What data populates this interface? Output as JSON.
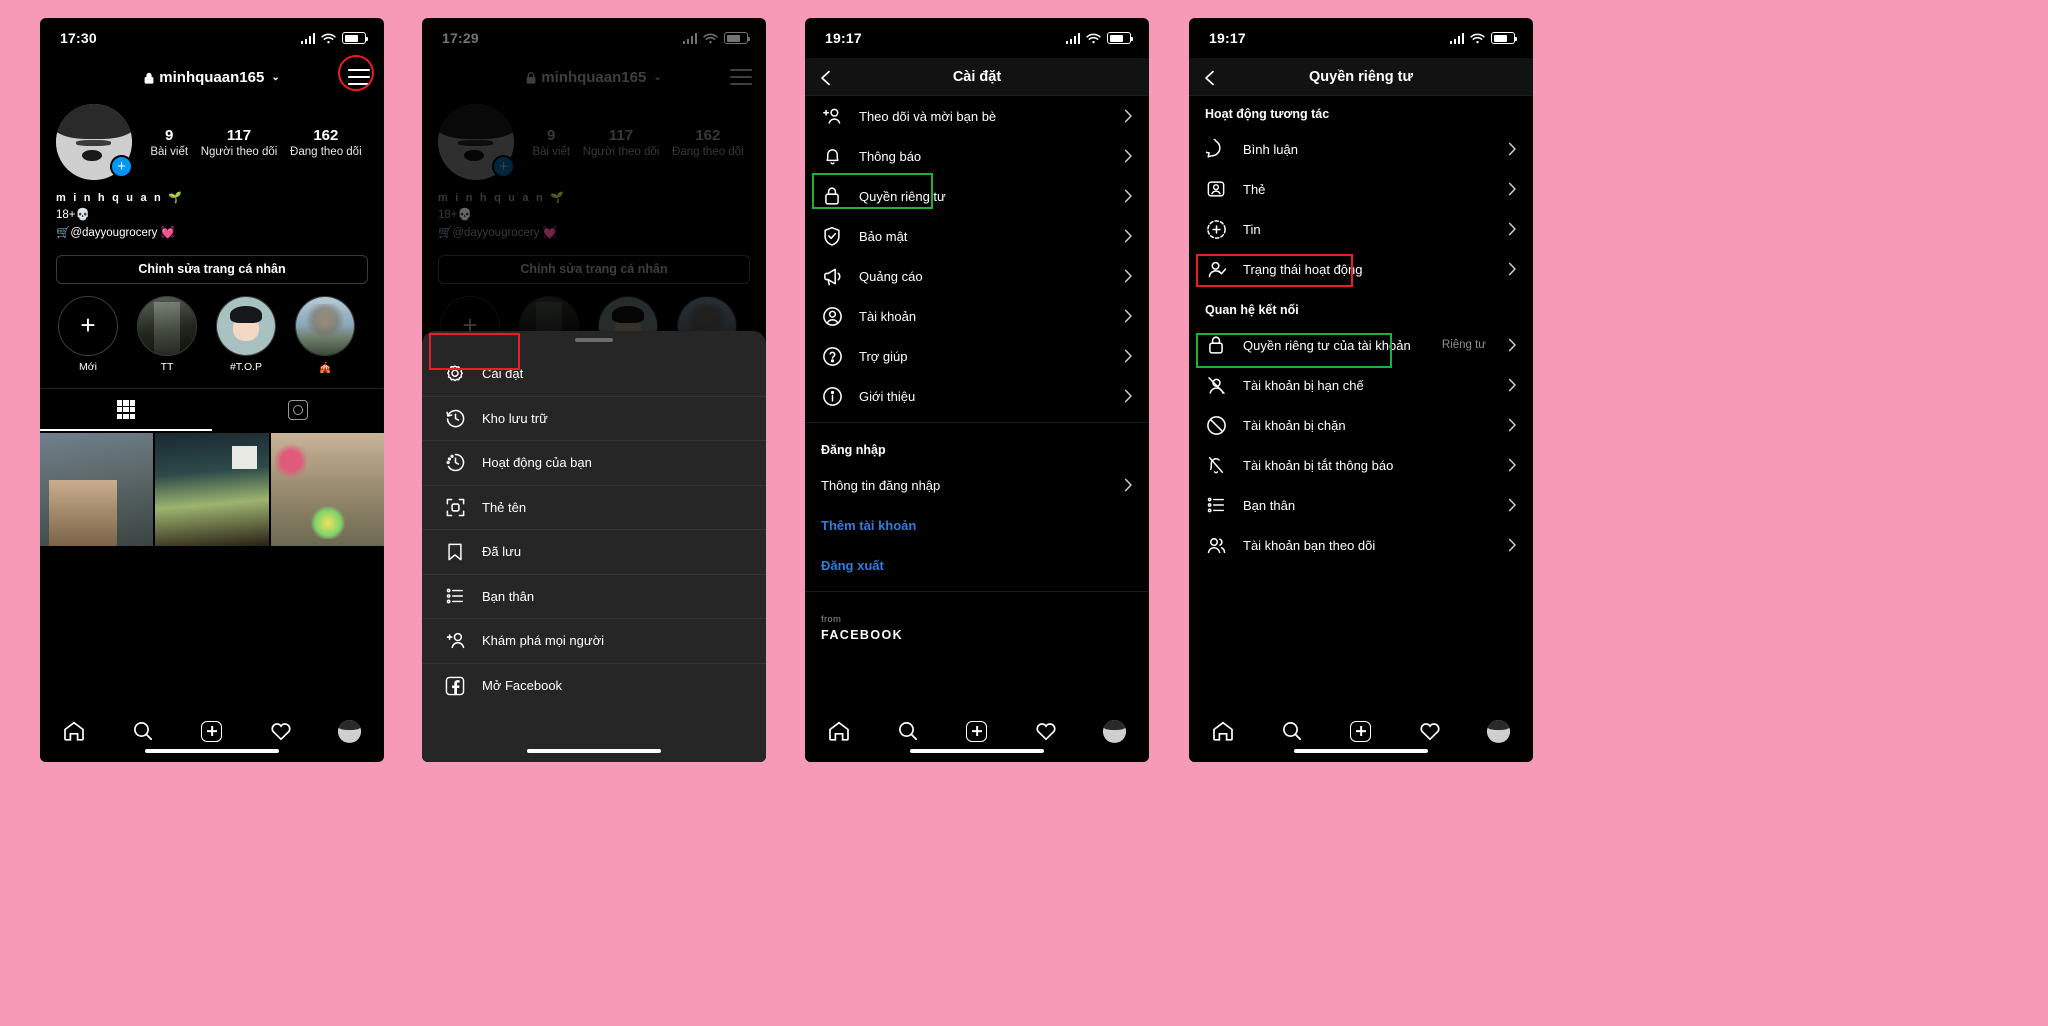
{
  "page": {
    "background_color": "#f79ab7"
  },
  "panels": [
    {
      "id": "profile",
      "status": {
        "time": "17:30"
      },
      "header": {
        "username": "minhquaan165",
        "lock_icon": "lock-icon",
        "chevron": "⌄",
        "menu_icon": "hamburger-menu-icon"
      },
      "stats": [
        {
          "num": "9",
          "label": "Bài viết"
        },
        {
          "num": "117",
          "label": "Người theo dõi"
        },
        {
          "num": "162",
          "label": "Đang theo dõi"
        }
      ],
      "bio": {
        "name": "m i n h q u a n 🌱",
        "line2": "18+💀",
        "line3": "🛒@dayyougrocery 💓"
      },
      "edit_button": "Chỉnh sửa trang cá nhân",
      "highlights": [
        {
          "label": "Mới",
          "icon": "plus-icon"
        },
        {
          "label": "TT"
        },
        {
          "label": "#T.O.P"
        },
        {
          "label": "🎪"
        }
      ],
      "tabs": [
        {
          "icon": "grid-icon",
          "active": true
        },
        {
          "icon": "tagged-icon",
          "active": false
        }
      ]
    },
    {
      "id": "menu-sheet",
      "status": {
        "time": "17:29"
      },
      "header": {
        "username": "minhquaan165",
        "chevron": "⌄",
        "menu_icon": "hamburger-menu-icon"
      },
      "stats": [
        {
          "num": "9",
          "label": "Bài viết"
        },
        {
          "num": "117",
          "label": "Người theo dõi"
        },
        {
          "num": "162",
          "label": "Đang theo dõi"
        }
      ],
      "bio": {
        "name": "m i n h q u a n 🌱",
        "line2": "18+💀",
        "line3": "🛒@dayyougrocery 💓"
      },
      "edit_button": "Chỉnh sửa trang cá nhân",
      "sheet_items": [
        {
          "label": "Cài đặt",
          "icon": "gear-icon",
          "highlighted": "red"
        },
        {
          "label": "Kho lưu trữ",
          "icon": "archive-clock-icon"
        },
        {
          "label": "Hoạt động của bạn",
          "icon": "activity-clock-icon"
        },
        {
          "label": "Thẻ tên",
          "icon": "nametag-icon"
        },
        {
          "label": "Đã lưu",
          "icon": "bookmark-icon"
        },
        {
          "label": "Bạn thân",
          "icon": "close-friends-list-icon"
        },
        {
          "label": "Khám phá mọi người",
          "icon": "discover-people-icon"
        },
        {
          "label": "Mở Facebook",
          "icon": "facebook-icon"
        }
      ]
    },
    {
      "id": "settings",
      "status": {
        "time": "19:17"
      },
      "navbar": {
        "title": "Cài đặt",
        "back_icon": "back-chevron-icon"
      },
      "items": [
        {
          "label": "Theo dõi và mời bạn bè",
          "icon": "add-person-icon"
        },
        {
          "label": "Thông báo",
          "icon": "bell-icon"
        },
        {
          "label": "Quyền riêng tư",
          "icon": "lock-icon",
          "highlighted": "green"
        },
        {
          "label": "Bảo mật",
          "icon": "shield-check-icon"
        },
        {
          "label": "Quảng cáo",
          "icon": "megaphone-icon"
        },
        {
          "label": "Tài khoản",
          "icon": "person-circle-icon"
        },
        {
          "label": "Trợ giúp",
          "icon": "question-circle-icon"
        },
        {
          "label": "Giới thiệu",
          "icon": "info-circle-icon"
        }
      ],
      "section_header": "Đăng nhập",
      "login_items": [
        {
          "label": "Thông tin đăng nhập",
          "chevron": true
        }
      ],
      "links": [
        "Thêm tài khoản",
        "Đăng xuất"
      ],
      "footer": {
        "from": "from",
        "brand": "FACEBOOK"
      }
    },
    {
      "id": "privacy",
      "status": {
        "time": "19:17"
      },
      "navbar": {
        "title": "Quyền riêng tư",
        "back_icon": "back-chevron-icon"
      },
      "section1_header": "Hoạt động tương tác",
      "section1_items": [
        {
          "label": "Bình luận",
          "icon": "comment-icon"
        },
        {
          "label": "Thẻ",
          "icon": "tag-person-icon"
        },
        {
          "label": "Tin",
          "icon": "story-plus-icon"
        },
        {
          "label": "Trạng thái hoạt động",
          "icon": "activity-status-icon",
          "highlighted": "red"
        }
      ],
      "section2_header": "Quan hệ kết nối",
      "section2_items": [
        {
          "label": "Quyền riêng tư của tài khoản",
          "icon": "lock-icon",
          "value": "Riêng tư",
          "highlighted": "green"
        },
        {
          "label": "Tài khoản bị hạn chế",
          "icon": "restricted-icon"
        },
        {
          "label": "Tài khoản bị chặn",
          "icon": "blocked-icon"
        },
        {
          "label": "Tài khoản bị tắt thông báo",
          "icon": "muted-icon"
        },
        {
          "label": "Bạn thân",
          "icon": "close-friends-list-icon"
        },
        {
          "label": "Tài khoản bạn theo dõi",
          "icon": "following-accounts-icon"
        }
      ]
    }
  ],
  "bottom_nav": [
    {
      "icon": "home-icon"
    },
    {
      "icon": "search-icon"
    },
    {
      "icon": "add-post-icon"
    },
    {
      "icon": "heart-icon"
    },
    {
      "icon": "profile-avatar-icon"
    }
  ],
  "annotations": {
    "red_color": "#ee1c25",
    "green_color": "#19b33c"
  }
}
